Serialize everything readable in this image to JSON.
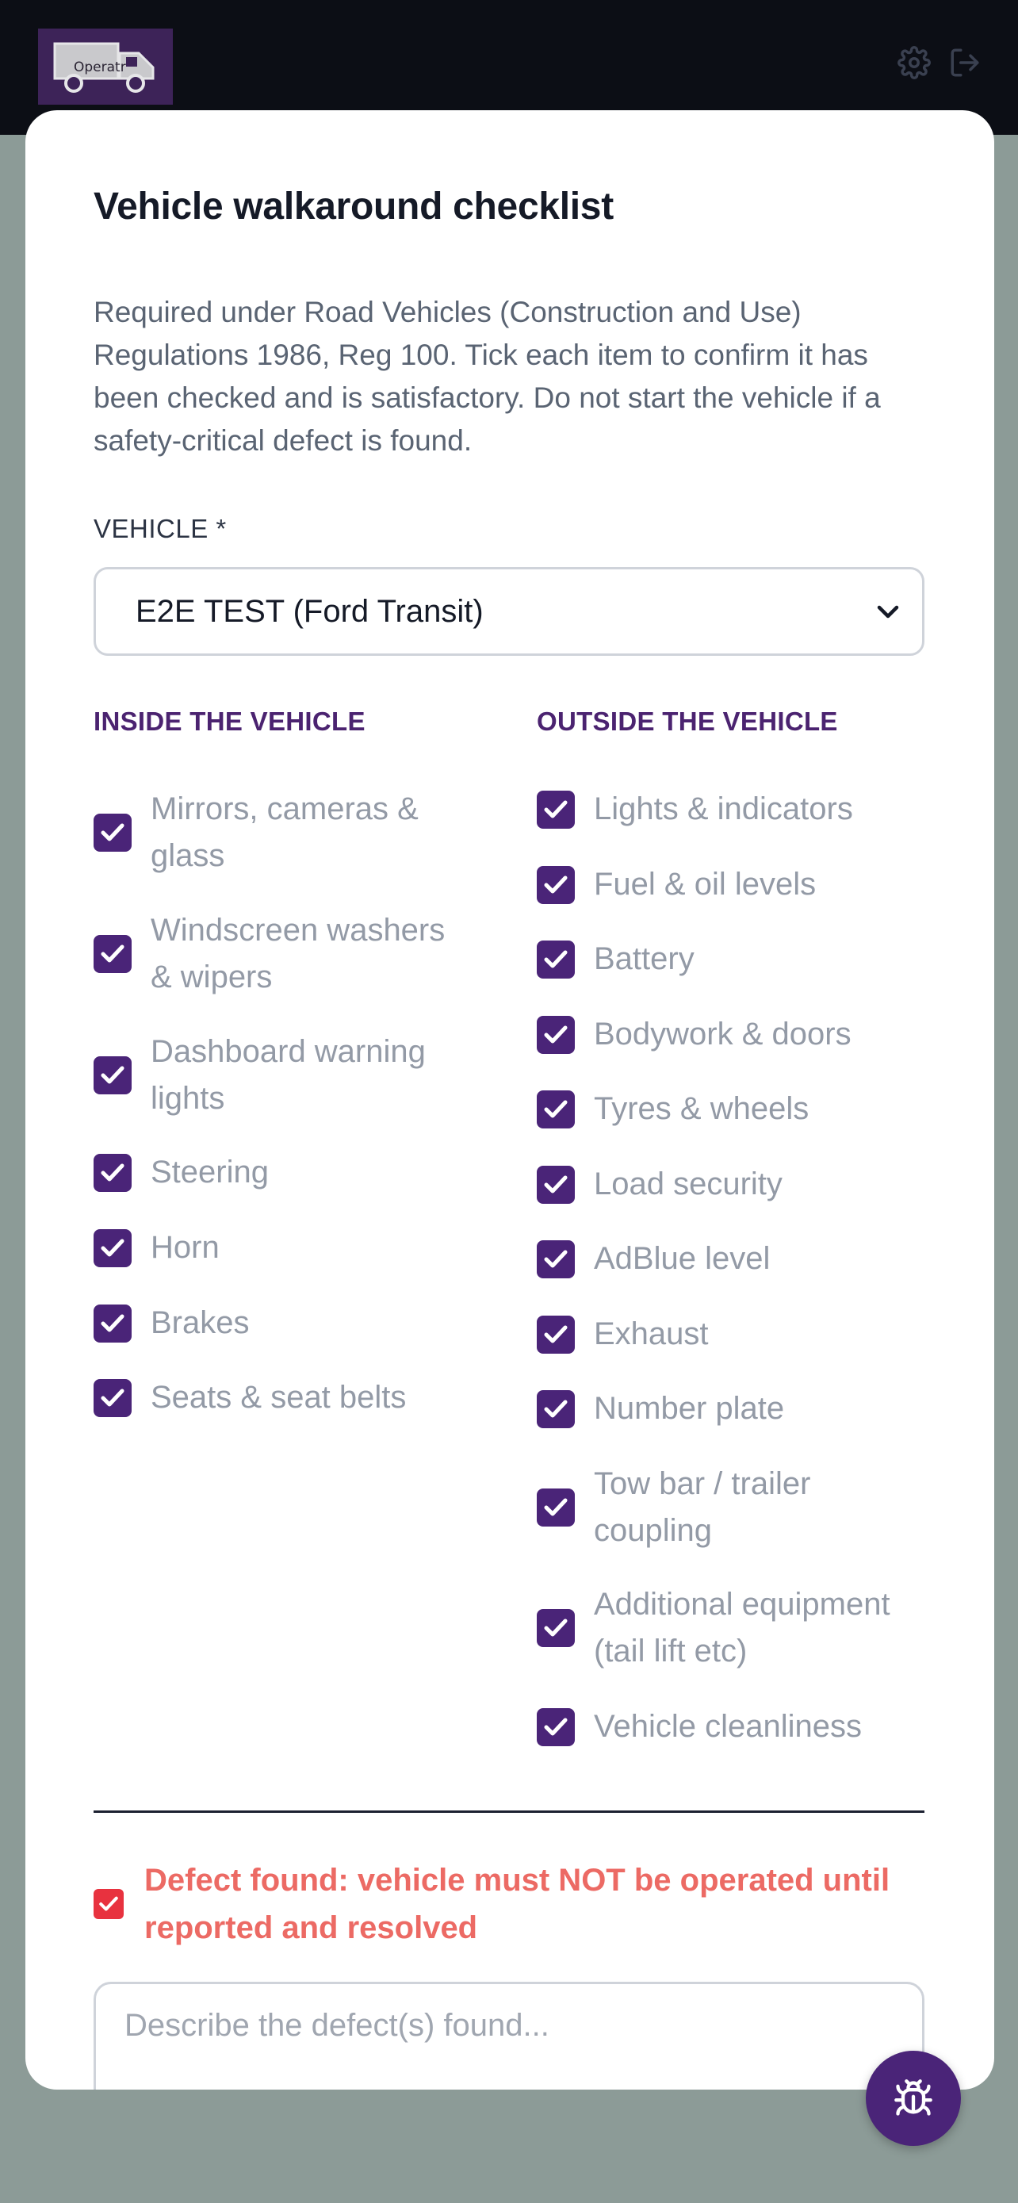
{
  "app": {
    "logo_text": "Operatr"
  },
  "header": {
    "icons": [
      "gear-icon",
      "logout-icon"
    ]
  },
  "modal": {
    "title": "Vehicle walkaround checklist",
    "intro": "Required under Road Vehicles (Construction and Use) Regulations 1986, Reg 100. Tick each item to confirm it has been checked and is satisfactory. Do not start the vehicle if a safety-critical defect is found.",
    "vehicle_label": "VEHICLE *",
    "vehicle_value": "E2E TEST (Ford Transit)",
    "inside": {
      "heading": "INSIDE THE VEHICLE",
      "items": [
        {
          "label": "Mirrors, cameras & glass",
          "checked": true
        },
        {
          "label": "Windscreen washers & wipers",
          "checked": true
        },
        {
          "label": "Dashboard warning lights",
          "checked": true
        },
        {
          "label": "Steering",
          "checked": true
        },
        {
          "label": "Horn",
          "checked": true
        },
        {
          "label": "Brakes",
          "checked": true
        },
        {
          "label": "Seats & seat belts",
          "checked": true
        }
      ]
    },
    "outside": {
      "heading": "OUTSIDE THE VEHICLE",
      "items": [
        {
          "label": "Lights & indicators",
          "checked": true
        },
        {
          "label": "Fuel & oil levels",
          "checked": true
        },
        {
          "label": "Battery",
          "checked": true
        },
        {
          "label": "Bodywork & doors",
          "checked": true
        },
        {
          "label": "Tyres & wheels",
          "checked": true
        },
        {
          "label": "Load security",
          "checked": true
        },
        {
          "label": "AdBlue level",
          "checked": true
        },
        {
          "label": "Exhaust",
          "checked": true
        },
        {
          "label": "Number plate",
          "checked": true
        },
        {
          "label": "Tow bar / trailer coupling",
          "checked": true
        },
        {
          "label": "Additional equipment (tail lift etc)",
          "checked": true
        },
        {
          "label": "Vehicle cleanliness",
          "checked": true
        }
      ]
    },
    "defect_label": "Defect found: vehicle must NOT be operated until reported and resolved",
    "defect_checked": true,
    "defect_placeholder": "Describe the defect(s) found..."
  },
  "colors": {
    "accent": "#4a2478",
    "danger": "#e8323f",
    "danger_text": "#ec6a64"
  }
}
